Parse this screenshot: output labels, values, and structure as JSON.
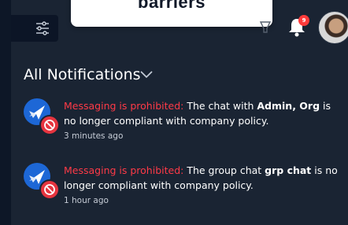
{
  "banner": {
    "text": "barriers"
  },
  "header": {
    "notification_count": "9",
    "icons": [
      "filter-sliders-icon",
      "tool-icon",
      "bell-icon",
      "avatar"
    ]
  },
  "panel": {
    "title": "All Notifications"
  },
  "notifications": [
    {
      "warning": "Messaging is prohibited:",
      "text_before": " The chat with ",
      "name": "Admin, Org",
      "text_after": " is no longer compliant with company policy.",
      "time": "3 minutes ago"
    },
    {
      "warning": "Messaging is prohibited:",
      "text_before": " The group chat ",
      "name": "grp chat",
      "text_after": " is no longer compliant with company policy.",
      "time": "1 hour ago"
    }
  ],
  "colors": {
    "warning": "#ff3a47",
    "badge": "#ff3b3b",
    "app_icon": "#1d67d6",
    "background": "#1a2433"
  }
}
